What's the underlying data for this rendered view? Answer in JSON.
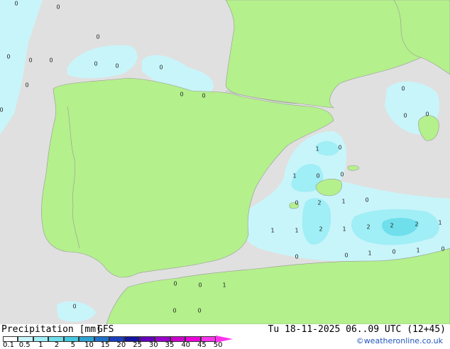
{
  "legend": {
    "title": "Precipitation [mm]",
    "model": "GFS",
    "ticks": [
      "0.1",
      "0.5",
      "1",
      "2",
      "5",
      "10",
      "15",
      "20",
      "25",
      "30",
      "35",
      "40",
      "45",
      "50"
    ],
    "colors": [
      "#ffffff",
      "#c8f5fa",
      "#a0eef6",
      "#6fdfec",
      "#46c9e0",
      "#2ea3d4",
      "#2070c8",
      "#1b3fbf",
      "#15159f",
      "#6600bb",
      "#9900cc",
      "#cc00cc",
      "#ee00dd",
      "#ff33ee"
    ]
  },
  "valid_time": "Tu 18-11-2025 06..09 UTC (12+45)",
  "credit": "©weatheronline.co.uk",
  "map": {
    "colors": {
      "sea": "#e0e0e0",
      "land": "#b4f08c",
      "precip_light": "#c8f5fa",
      "precip_medium": "#a0eef6",
      "precip_heavy": "#6fdfec",
      "border": "#999999"
    },
    "labels": [
      "0",
      "0",
      "0",
      "0",
      "0",
      "0",
      "0",
      "0",
      "0",
      "0",
      "0",
      "0",
      "0",
      "0",
      "1",
      "0",
      "1",
      "0",
      "0",
      "0",
      "2",
      "1",
      "0",
      "1",
      "1",
      "2",
      "1",
      "2",
      "2",
      "2",
      "1",
      "0",
      "0",
      "1",
      "0",
      "1",
      "0",
      "0",
      "0",
      "0",
      "1",
      "0",
      "0",
      "0",
      "0"
    ]
  }
}
